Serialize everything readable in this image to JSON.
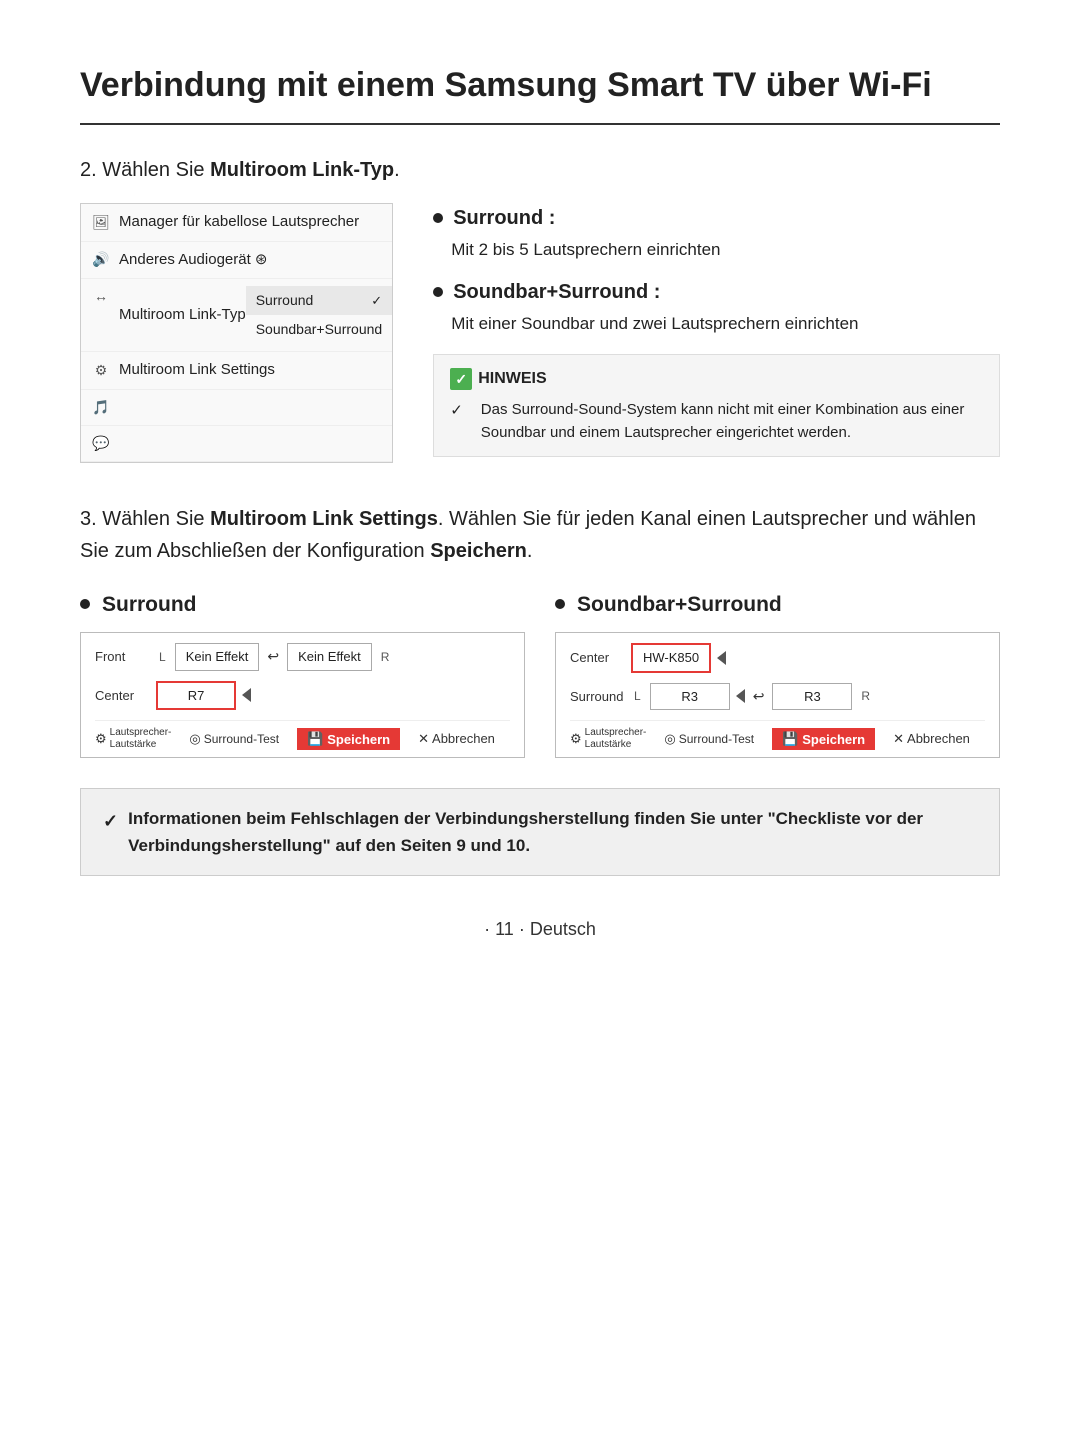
{
  "page": {
    "title": "Verbindung mit einem Samsung Smart TV über Wi-Fi",
    "footer": "· 11 · Deutsch"
  },
  "step2": {
    "intro": "2. Wählen Sie ",
    "intro_bold": "Multiroom Link-Typ",
    "intro_end": ".",
    "menu": {
      "rows": [
        {
          "icon": "🖼",
          "label": "Manager für kabellose Lautsprecher",
          "hasSubmenu": false
        },
        {
          "icon": "🔊",
          "label": "Anderes Audiogerät ⊛",
          "hasSubmenu": false
        },
        {
          "icon": "↔",
          "label": "Multiroom Link-Typ",
          "hasSubmenu": true,
          "submenu": [
            "Surround",
            "Soundbar+Surround"
          ],
          "active": 0
        },
        {
          "icon": "⚙",
          "label": "Multiroom Link Settings",
          "hasSubmenu": false
        },
        {
          "icon": "🎵",
          "label": "",
          "hasSubmenu": false
        },
        {
          "icon": "💬",
          "label": "",
          "hasSubmenu": false
        }
      ]
    },
    "options": [
      {
        "title": "Surround :",
        "desc": "Mit 2 bis 5 Lautsprechern einrichten"
      },
      {
        "title": "Soundbar+Surround :",
        "desc": "Mit einer Soundbar und zwei Lautsprechern einrichten"
      }
    ],
    "hinweis": {
      "title": "HINWEIS",
      "text": "Das Surround-Sound-System kann nicht mit einer Kombination aus einer Soundbar und einem Lautsprecher eingerichtet werden."
    }
  },
  "step3": {
    "intro_start": "3. Wählen Sie ",
    "intro_bold1": "Multiroom Link Settings",
    "intro_mid": ". Wählen Sie für jeden Kanal einen Lautsprecher und wählen Sie zum Abschließen der Konfiguration ",
    "intro_bold2": "Speichern",
    "intro_end": ".",
    "panels": [
      {
        "title": "Surround",
        "rows": [
          {
            "label": "Front",
            "leftChannel": "L",
            "leftBox": "Kein Effekt",
            "hasArrow": true,
            "rightBox": "Kein Effekt",
            "rightChannel": "R",
            "highlighted": false
          },
          {
            "label": "Center",
            "leftChannel": "",
            "leftBox": "",
            "hasArrow": false,
            "rightBox": "R7",
            "rightChannel": "",
            "highlighted": true
          }
        ],
        "toolbar": {
          "speaker": "Lautsprecher-Lautstärke",
          "test": "Surround-Test",
          "save": "Speichern",
          "cancel": "Abbrechen"
        }
      },
      {
        "title": "Soundbar+Surround",
        "rows": [
          {
            "label": "Center",
            "leftChannel": "",
            "leftBox": "",
            "hasArrow": false,
            "rightBox": "HW-K850",
            "rightChannel": "",
            "highlighted": true
          },
          {
            "label": "Surround",
            "leftChannel": "L",
            "leftBox": "R3",
            "hasArrow": true,
            "rightBox": "R3",
            "rightChannel": "R",
            "highlighted": false
          }
        ],
        "toolbar": {
          "speaker": "Lautsprecher-Lautstärke",
          "test": "Surround-Test",
          "save": "Speichern",
          "cancel": "Abbrechen"
        }
      }
    ]
  },
  "bottom_note": "Informationen beim Fehlschlagen der Verbindungsherstellung finden Sie unter \"Checkliste vor der Verbindungsherstellung\" auf den Seiten 9 und 10."
}
